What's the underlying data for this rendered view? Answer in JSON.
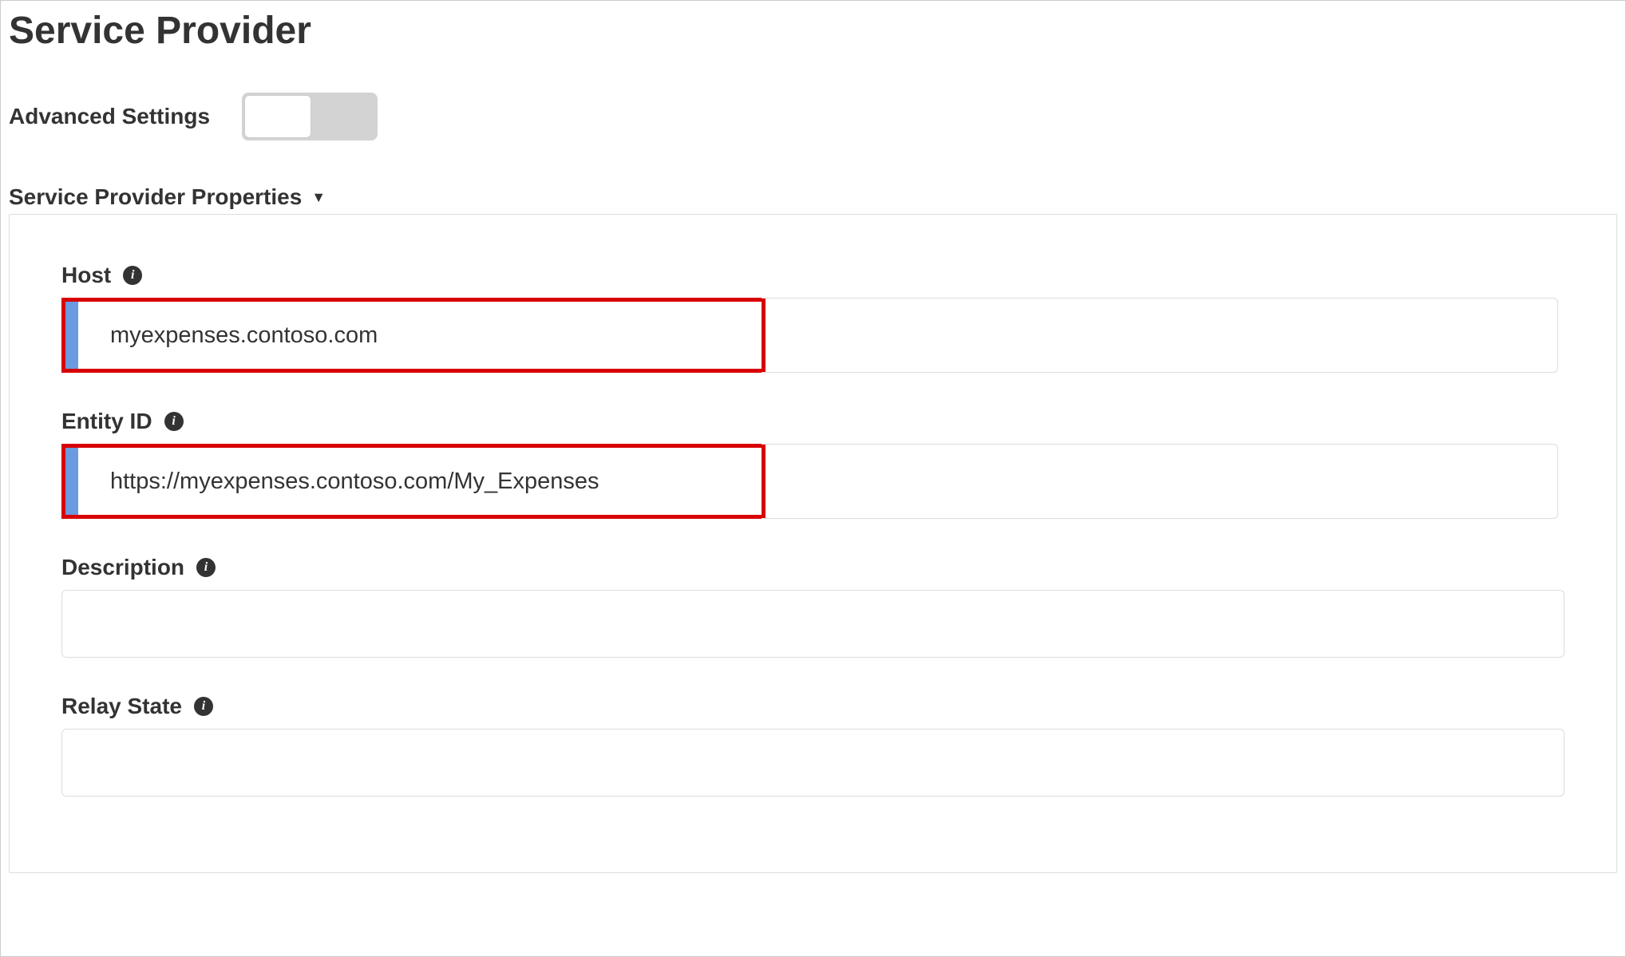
{
  "page_title": "Service Provider",
  "advanced_settings_label": "Advanced Settings",
  "advanced_settings_enabled": false,
  "section_title": "Service Provider Properties",
  "fields": {
    "host": {
      "label": "Host",
      "value": "myexpenses.contoso.com"
    },
    "entity_id": {
      "label": "Entity ID",
      "value": "https://myexpenses.contoso.com/My_Expenses"
    },
    "description": {
      "label": "Description",
      "value": ""
    },
    "relay_state": {
      "label": "Relay State",
      "value": ""
    }
  }
}
